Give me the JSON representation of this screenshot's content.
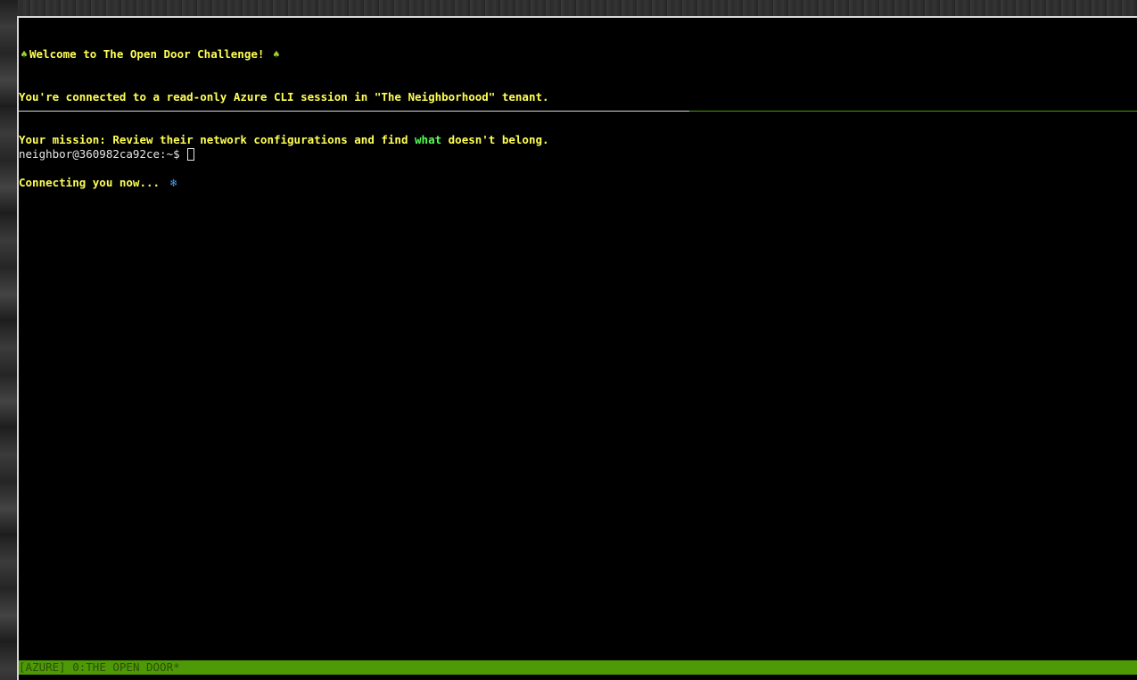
{
  "terminal": {
    "banner": {
      "welcome": "Welcome to The Open Door Challenge! ",
      "ornament_icon": "ornament-icon",
      "line2": "You're connected to a read-only Azure CLI session in \"The Neighborhood\" tenant.",
      "line3_before": "Your mission: Review their network configurations and find ",
      "line3_highlight": "what",
      "line3_after": " doesn't belong.",
      "line4": "Connecting you now... ",
      "snow_icon": "snowflake-icon"
    },
    "prompt": "neighbor@360982ca92ce:~$"
  },
  "status_bar": {
    "session": "[AZURE]",
    "window": "0:THE OPEN DOOR*"
  },
  "colors": {
    "banner_text": "#ffff55",
    "highlight": "#55ff55",
    "status_bar_bg": "#4e9a06",
    "divider_active": "#4e9a06"
  }
}
